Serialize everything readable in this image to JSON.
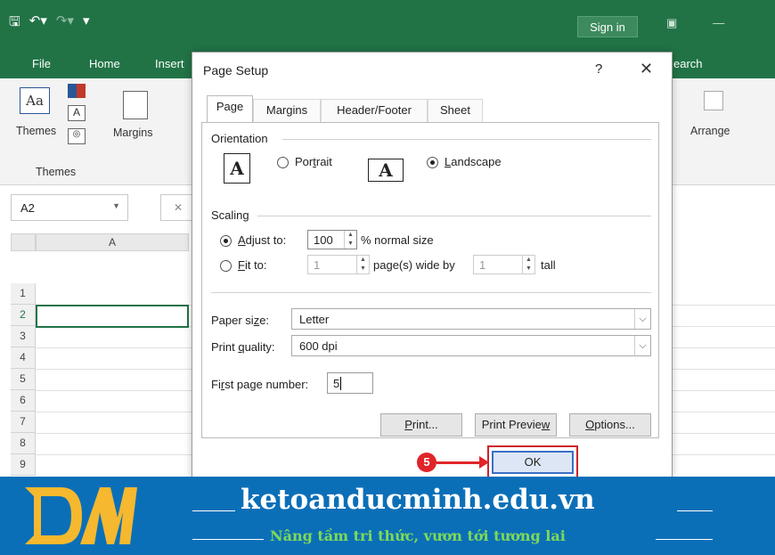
{
  "excel": {
    "signin": "Sign in",
    "tabs": {
      "file": "File",
      "home": "Home",
      "insert": "Insert",
      "search": "earch"
    },
    "ribbon": {
      "themes": "Themes",
      "themes_group": "Themes",
      "margins": "Margins",
      "arrange": "Arrange"
    },
    "name_box": "A2",
    "column_a": "A",
    "rows": [
      "1",
      "2",
      "3",
      "4",
      "5",
      "6",
      "7",
      "8",
      "9"
    ]
  },
  "dialog": {
    "title": "Page Setup",
    "help": "?",
    "close": "✕",
    "tabs": [
      "Page",
      "Margins",
      "Header/Footer",
      "Sheet"
    ],
    "orientation": {
      "label": "Orientation",
      "portrait": "Portrait",
      "landscape": "Landscape",
      "selected": "Landscape"
    },
    "scaling": {
      "label": "Scaling",
      "adjust_to": "Adjust to:",
      "adjust_value": "100",
      "percent_suffix": "% normal size",
      "fit_to": "Fit to:",
      "fit_wide": "1",
      "pages_wide_by": "page(s) wide by",
      "fit_tall": "1",
      "tall": "tall"
    },
    "paper_size": {
      "label": "Paper size:",
      "value": "Letter"
    },
    "print_quality": {
      "label": "Print quality:",
      "value": "600 dpi"
    },
    "first_page_number": {
      "label": "First page number:",
      "value": "5"
    },
    "buttons": {
      "print": "Print...",
      "print_preview": "Print Preview",
      "options": "Options...",
      "ok": "OK"
    }
  },
  "annotation": {
    "step": "5"
  },
  "banner": {
    "site": "ketoanducminh.edu.vn",
    "slogan": "Nâng tầm tri thức, vươn tới tương lai",
    "accent": "#0b6fb8",
    "slogan_color": "#7ed957"
  }
}
